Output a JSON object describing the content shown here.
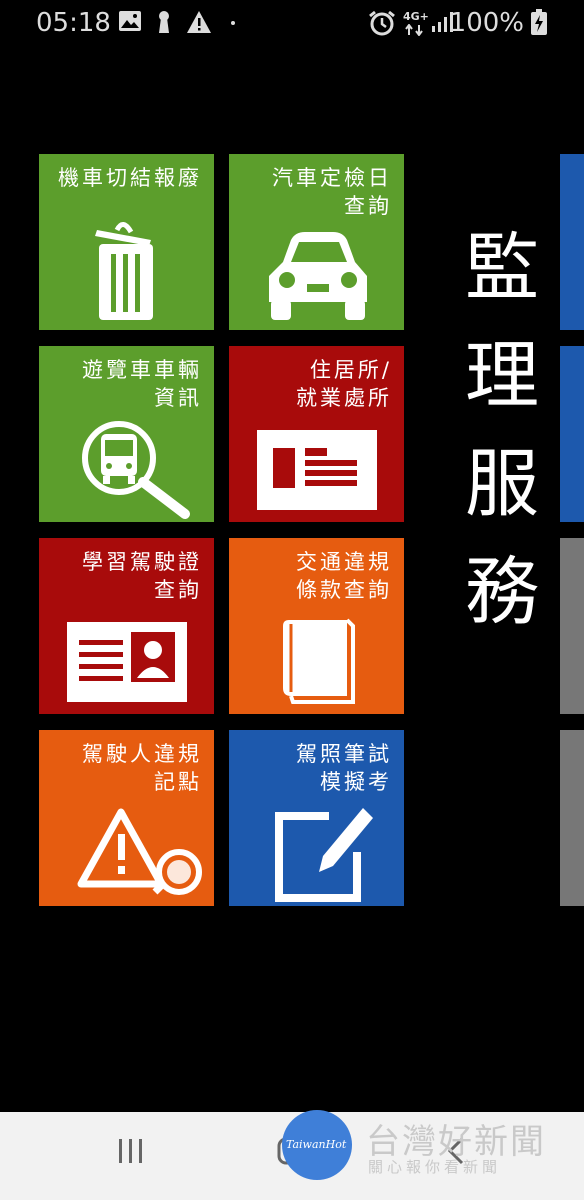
{
  "status_bar": {
    "time": "05:18",
    "network": "4G+",
    "battery": "100%"
  },
  "tiles": [
    {
      "label": "機車切結報廢",
      "icon": "trash-can-icon",
      "color": "#5c9e2c"
    },
    {
      "label": "汽車定檢日\n查詢",
      "icon": "car-icon",
      "color": "#5c9e2c"
    },
    {
      "label": "遊覽車車輛\n資訊",
      "icon": "bus-magnifier-icon",
      "color": "#5c9e2c"
    },
    {
      "label": "住居所/\n就業處所",
      "icon": "address-card-icon",
      "color": "#a80b0b"
    },
    {
      "label": "學習駕駛證\n查詢",
      "icon": "id-card-icon",
      "color": "#a80b0b"
    },
    {
      "label": "交通違規\n條款查詢",
      "icon": "book-icon",
      "color": "#e65c10"
    },
    {
      "label": "駕駛人違規\n記點",
      "icon": "warning-magnifier-icon",
      "color": "#e65c10"
    },
    {
      "label": "駕照筆試\n模擬考",
      "icon": "edit-pencil-icon",
      "color": "#1d59ad"
    }
  ],
  "section_title": [
    "監",
    "理",
    "服",
    "務"
  ],
  "watermark": {
    "logo": "TaiwanHot",
    "title": "台灣好新聞",
    "subtitle": "關心報你看新聞"
  }
}
